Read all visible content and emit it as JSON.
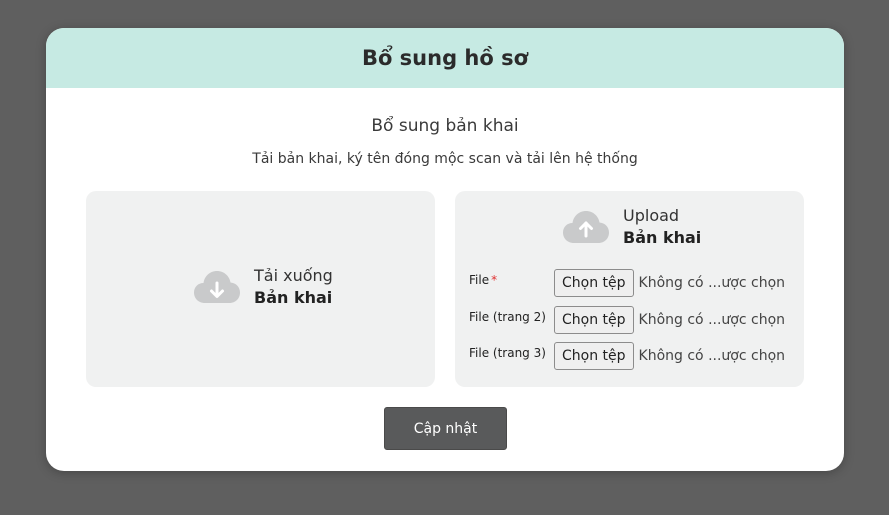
{
  "modal": {
    "title": "Bổ sung hồ sơ",
    "section_title": "Bổ sung bản khai",
    "section_subtitle": "Tải bản khai, ký tên đóng mộc scan và tải lên hệ thống",
    "header_color": "#c6eae3"
  },
  "download": {
    "icon": "cloud-download-icon",
    "line1": "Tải xuống",
    "line2": "Bản khai"
  },
  "upload": {
    "icon": "cloud-upload-icon",
    "line1": "Upload",
    "line2": "Bản khai",
    "files": [
      {
        "label": "File",
        "required_mark": "*",
        "button": "Chọn tệp",
        "status": "Không có ...ược chọn"
      },
      {
        "label": "File (trang 2)",
        "button": "Chọn tệp",
        "status": "Không có ...ược chọn"
      },
      {
        "label": "File (trang 3)",
        "button": "Chọn tệp",
        "status": "Không có ...ược chọn"
      }
    ]
  },
  "actions": {
    "update_label": "Cập nhật"
  }
}
